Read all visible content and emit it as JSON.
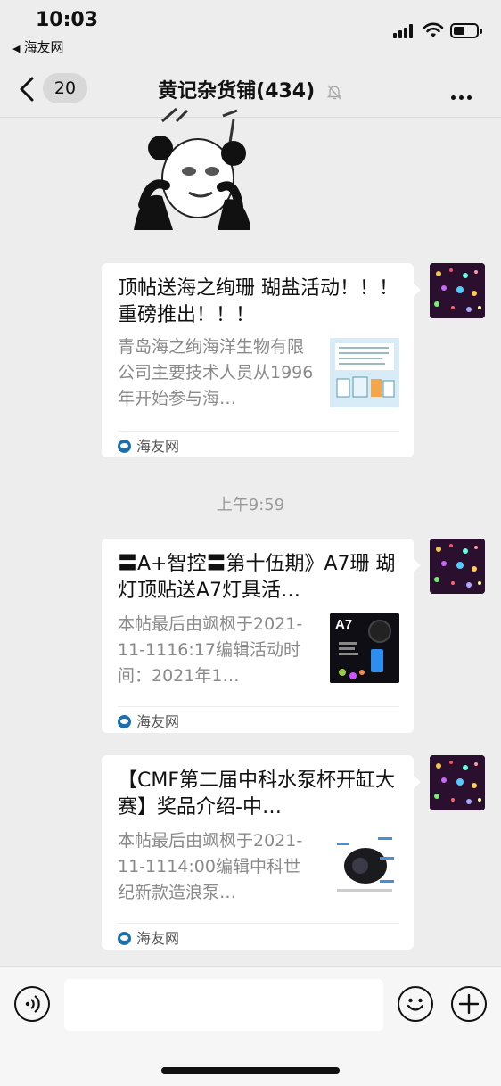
{
  "status_bar": {
    "time": "10:03",
    "back_app": "海友网"
  },
  "nav": {
    "back_count": "20",
    "title": "黄记杂货铺(434)"
  },
  "timestamp": "上午9:59",
  "messages": [
    {
      "title": "顶帖送海之绚珊 瑚盐活动！！！ 重磅推出！！！",
      "description": "青岛海之绚海洋生物有限公司主要技术人员从1996年开始参与海…",
      "source": "海友网"
    },
    {
      "title": "〓A+智控〓第十伍期》A7珊 瑚灯顶贴送A7灯具活…",
      "description": "本帖最后由飒枫于2021-11-1116:17编辑活动时间：2021年1…",
      "thumb_label": "A7",
      "source": "海友网"
    },
    {
      "title": "【CMF第二届中科水泵杯开缸大赛】奖品介绍-中…",
      "description": "本帖最后由飒枫于2021-11-1114:00编辑中科世纪新款造浪泵…",
      "source": "海友网"
    }
  ],
  "colors": {
    "background": "#ededed",
    "card": "#ffffff",
    "muted_text": "#8a8a8a"
  },
  "icons": [
    "back-chevron-icon",
    "mute-bell-icon",
    "more-dots-icon",
    "voice-icon",
    "emoji-icon",
    "plus-icon",
    "source-logo-icon"
  ]
}
